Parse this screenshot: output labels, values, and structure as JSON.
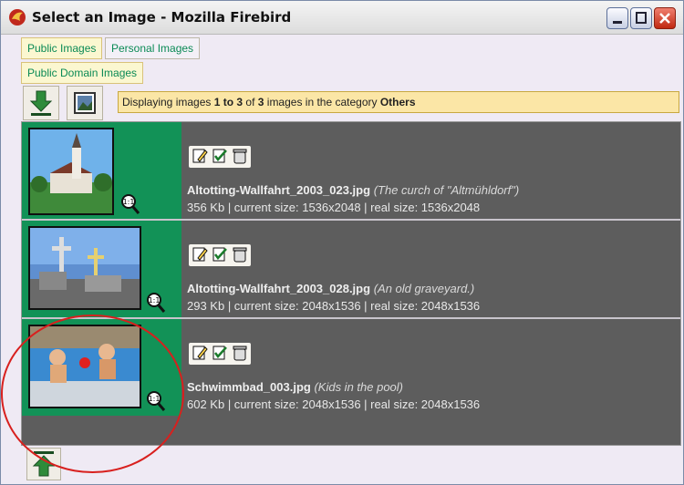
{
  "window": {
    "title": "Select an Image - Mozilla Firebird"
  },
  "tabs": [
    {
      "label": "Public Images",
      "active": true
    },
    {
      "label": "Personal Images",
      "active": false
    },
    {
      "label": "Public Domain Images",
      "active": true
    }
  ],
  "toolbar": {
    "status": {
      "prefix": "Displaying images ",
      "range": "1 to 3",
      "mid": " of ",
      "total": "3",
      "cat_text": " images in the category ",
      "category": "Others"
    }
  },
  "images": [
    {
      "filename": "Altotting-Wallfahrt_2003_023.jpg",
      "caption": "(The curch of \"Altmühldorf\")",
      "meta": "356 Kb | current size: 1536x2048 | real size: 1536x2048"
    },
    {
      "filename": "Altotting-Wallfahrt_2003_028.jpg",
      "caption": "(An old graveyard.)",
      "meta": "293 Kb | current size: 2048x1536 | real size: 2048x1536"
    },
    {
      "filename": "Schwimmbad_003.jpg",
      "caption": "(Kids in the pool)",
      "meta": "602 Kb | current size: 2048x1536 | real size: 2048x1536"
    }
  ],
  "icons": {
    "toolbar": [
      "download-icon",
      "picture-icon"
    ],
    "row": [
      "zoom-icon",
      "edit-icon",
      "edit-check-icon",
      "trash-icon"
    ],
    "bottom": [
      "upload-icon"
    ]
  },
  "colors": {
    "thumb_bg": "#129257",
    "list_bg": "#5d5d5d",
    "status_bg": "#fbe6a6",
    "tab_text": "#0a8a55",
    "highlight_circle": "#d8201e"
  }
}
